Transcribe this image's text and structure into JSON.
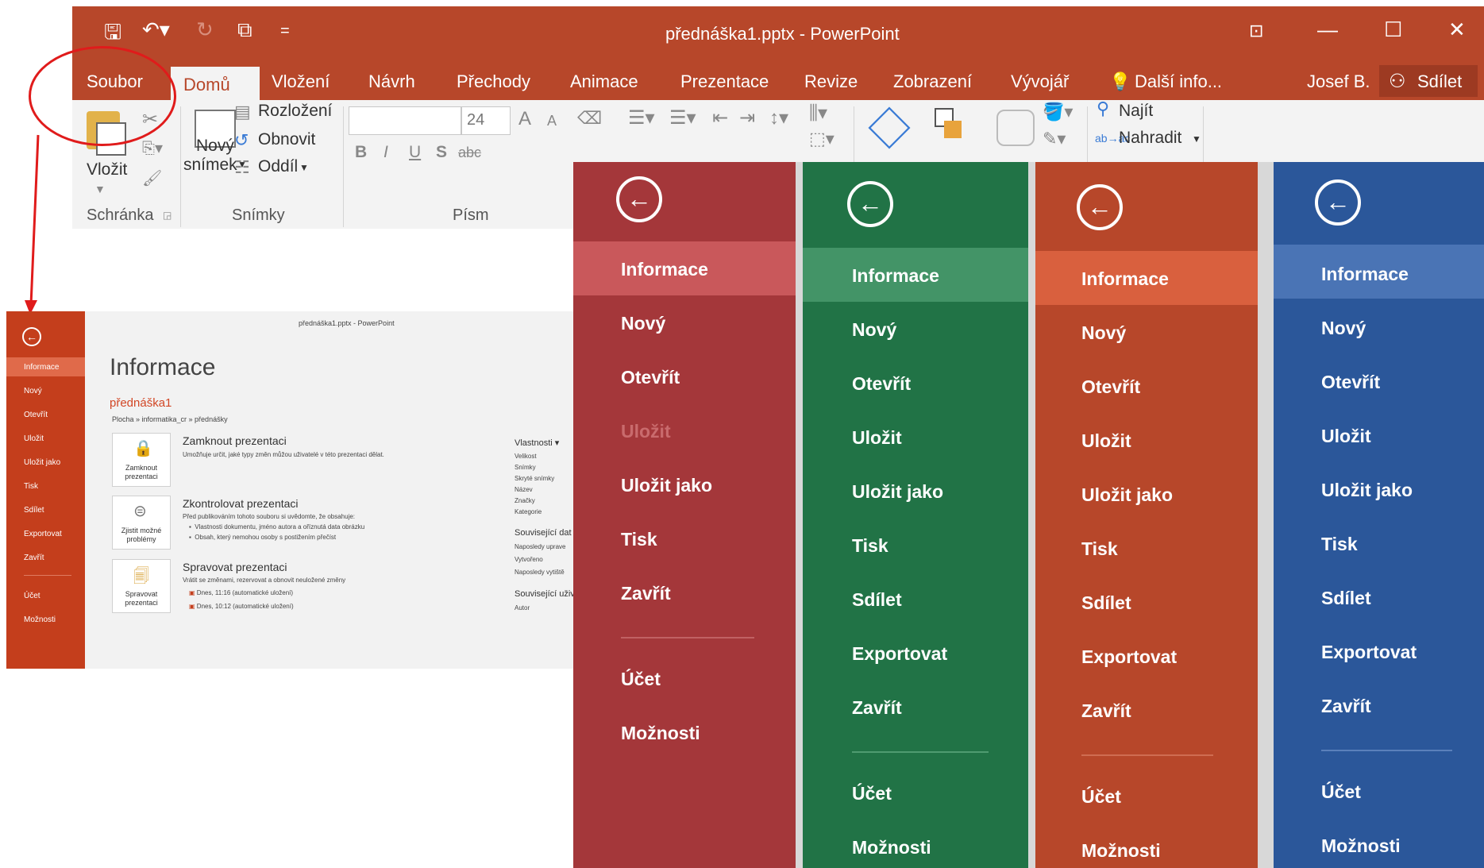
{
  "window": {
    "title": "přednáška1.pptx - PowerPoint",
    "qat_more": "=",
    "controls": {
      "ribbon_display": "⊡",
      "minimize": "—",
      "maximize": "☐",
      "close": "✕"
    }
  },
  "tabs": [
    "Soubor",
    "Domů",
    "Vložení",
    "Návrh",
    "Přechody",
    "Animace",
    "Prezentace",
    "Revize",
    "Zobrazení",
    "Vývojář"
  ],
  "tell_me": "Další info...",
  "user": "Josef B.",
  "share": "Sdílet",
  "ribbon": {
    "paste": "Vložit",
    "clipboard_group": "Schránka",
    "new_slide_line1": "Nový",
    "new_slide_line2": "snímek",
    "layout": "Rozložení",
    "reset": "Obnovit",
    "section": "Oddíl",
    "slides_group": "Snímky",
    "font_size": "24",
    "font_group": "Písm",
    "bold": "B",
    "italic": "I",
    "underline": "U",
    "shadow": "S",
    "strike": "abc",
    "grow": "A",
    "shrink": "A",
    "find": "Najít",
    "replace": "Nahradit"
  },
  "backstage": {
    "window_title": "přednáška1.pptx - PowerPoint",
    "menu": [
      "Informace",
      "Nový",
      "Otevřít",
      "Uložit",
      "Uložit jako",
      "Tisk",
      "Sdílet",
      "Exportovat",
      "Zavřít",
      "Účet",
      "Možnosti"
    ],
    "heading": "Informace",
    "file_name": "přednáška1",
    "path": "Plocha » informatika_cr » přednášky",
    "protect": {
      "card": "Zamknout prezentaci",
      "title": "Zamknout prezentaci",
      "desc": "Umožňuje určit, jaké typy změn můžou uživatelé v této prezentaci dělat."
    },
    "inspect": {
      "card": "Zjistit možné problémy",
      "title": "Zkontrolovat prezentaci",
      "desc": "Před publikováním tohoto souboru si uvědomte, že obsahuje:",
      "bullets": [
        "Vlastnosti dokumentu, jméno autora a oříznutá data obrázku",
        "Obsah, který nemohou osoby s postižením přečíst"
      ]
    },
    "manage": {
      "card": "Spravovat prezentaci",
      "title": "Spravovat prezentaci",
      "desc": "Vrátit se změnami, rezervovat a obnovit neuložené změny",
      "versions": [
        "Dnes, 11:16 (automatické uložení)",
        "Dnes, 10:12 (automatické uložení)"
      ]
    },
    "properties": {
      "heading": "Vlastnosti",
      "items": [
        "Velikost",
        "Snímky",
        "Skryté snímky",
        "Název",
        "Značky",
        "Kategorie"
      ],
      "related_dates": "Související dat",
      "dates": [
        "Naposledy uprave",
        "Vytvořeno",
        "Naposledy vytiště"
      ],
      "related_people": "Související uživ",
      "people": [
        "Autor"
      ]
    }
  },
  "panels": [
    {
      "theme": "powerpoint-red",
      "items_top": [
        "Informace",
        "Nový",
        "Otevřít",
        "Uložit",
        "Uložit jako",
        "Tisk",
        "Zavřít"
      ],
      "items_bottom": [
        "Účet",
        "Možnosti"
      ],
      "colors": {
        "bg": "#a4373a",
        "selected": "#c9585b",
        "divider": "#c06163",
        "disabled_text": "#c96b6d"
      }
    },
    {
      "theme": "excel-green",
      "items_top": [
        "Informace",
        "Nový",
        "Otevřít",
        "Uložit",
        "Uložit jako",
        "Tisk",
        "Sdílet",
        "Exportovat",
        "Zavřít"
      ],
      "items_bottom": [
        "Účet",
        "Možnosti"
      ],
      "colors": {
        "bg": "#217346",
        "selected": "#439467",
        "divider": "#4f9b70"
      }
    },
    {
      "theme": "powerpoint-orange",
      "items_top": [
        "Informace",
        "Nový",
        "Otevřít",
        "Uložit",
        "Uložit jako",
        "Tisk",
        "Sdílet",
        "Exportovat",
        "Zavřít"
      ],
      "items_bottom": [
        "Účet",
        "Možnosti"
      ],
      "colors": {
        "bg": "#b7472a",
        "selected": "#d9603e",
        "divider": "#cf6d52"
      }
    },
    {
      "theme": "word-blue",
      "items_top": [
        "Informace",
        "Nový",
        "Otevřít",
        "Uložit",
        "Uložit jako",
        "Tisk",
        "Sdílet",
        "Exportovat",
        "Zavřít"
      ],
      "items_bottom": [
        "Účet",
        "Možnosti"
      ],
      "colors": {
        "bg": "#2b579a",
        "selected": "#4a74b5",
        "divider": "#5a80bb"
      }
    }
  ]
}
